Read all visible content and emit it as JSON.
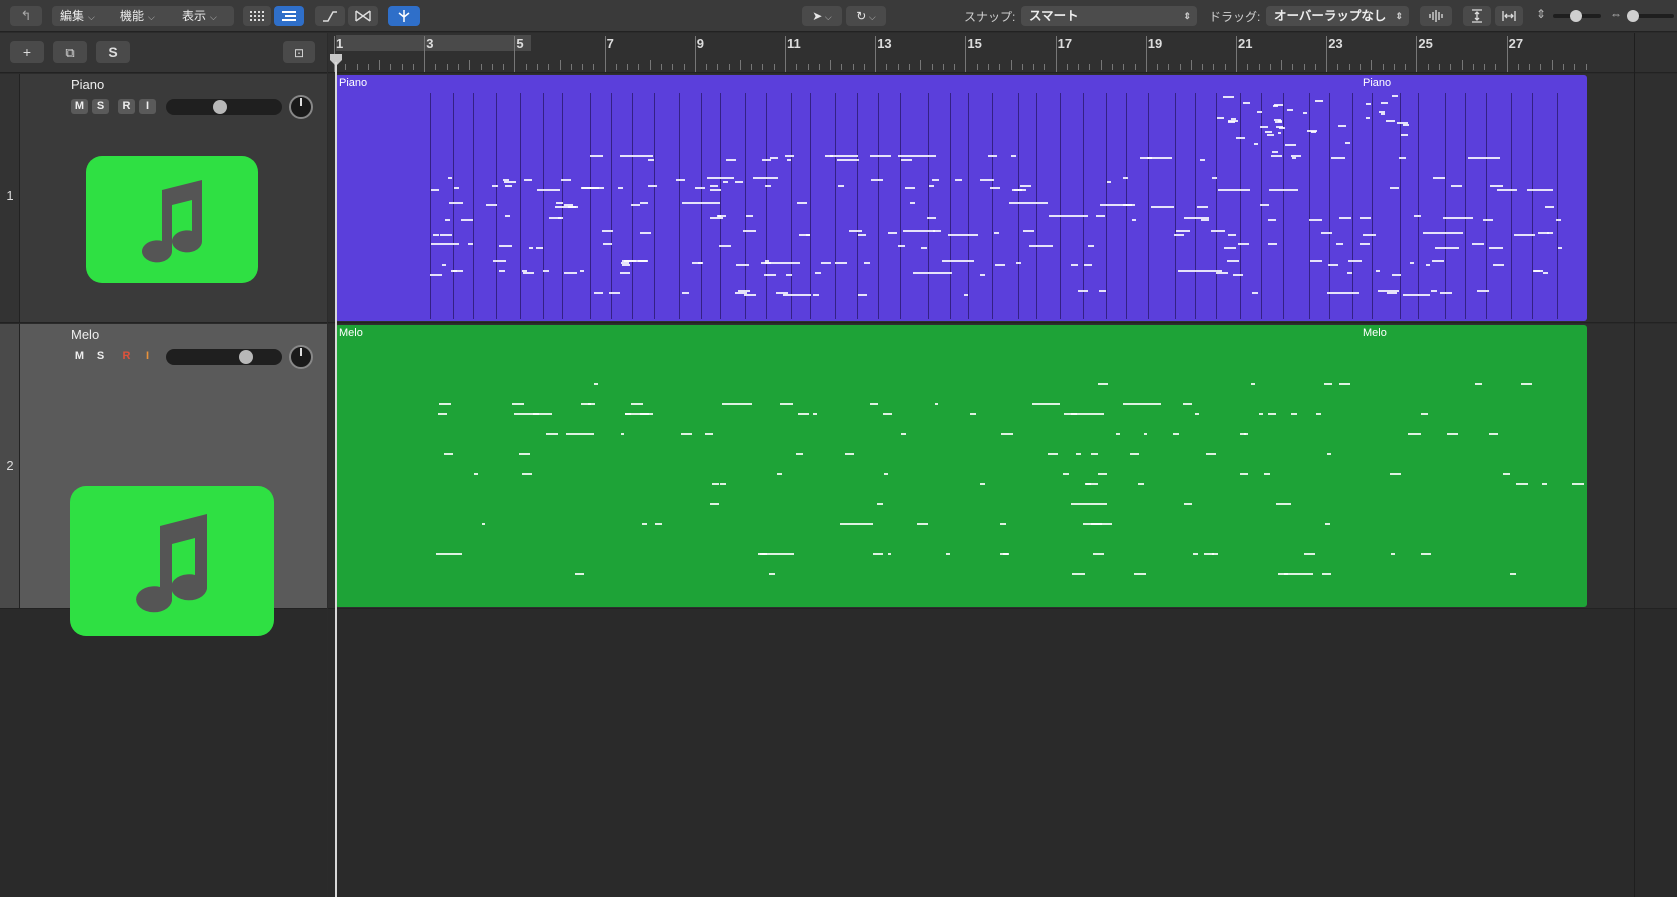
{
  "toolbar": {
    "back_icon": "back-arrow-icon",
    "menus": [
      {
        "label": "編集"
      },
      {
        "label": "機能"
      },
      {
        "label": "表示"
      }
    ],
    "snap_label": "スナップ:",
    "snap_value": "スマート",
    "drag_label": "ドラッグ:",
    "drag_value": "オーバーラップなし",
    "tools": [
      "grid-view-icon",
      "list-view-icon",
      "automation-icon",
      "flex-icon",
      "catch-icon",
      "pointer-tool-icon",
      "loop-tool-icon",
      "waveform-zoom-icon",
      "vertical-fit-icon",
      "horizontal-fit-icon"
    ],
    "vertical_zoom": 0.5,
    "horizontal_zoom": 0.35
  },
  "header_toolbar": {
    "add_label": "+",
    "duplicate_icon": "duplicate-track-icon",
    "solo_label": "S",
    "folder_icon": "track-folder-icon"
  },
  "ruler": {
    "bars": [
      "1",
      "3",
      "5",
      "7",
      "9",
      "11",
      "13",
      "15",
      "17",
      "19",
      "21",
      "23",
      "25",
      "27"
    ]
  },
  "tracks": [
    {
      "number": "1",
      "name": "Piano",
      "m": "M",
      "s": "S",
      "r": "R",
      "i": "I",
      "record_armed": false,
      "volume": 0.45,
      "icon": "music-note-icon",
      "region_color": "#5b3fdb",
      "region_label": "Piano",
      "region_label_repeat": "Piano"
    },
    {
      "number": "2",
      "name": "Melo",
      "m": "M",
      "s": "S",
      "r": "R",
      "i": "I",
      "record_armed": true,
      "volume": 0.68,
      "icon": "music-note-icon",
      "region_color": "#1ea337",
      "region_label": "Melo",
      "region_label_repeat": "Melo"
    }
  ]
}
